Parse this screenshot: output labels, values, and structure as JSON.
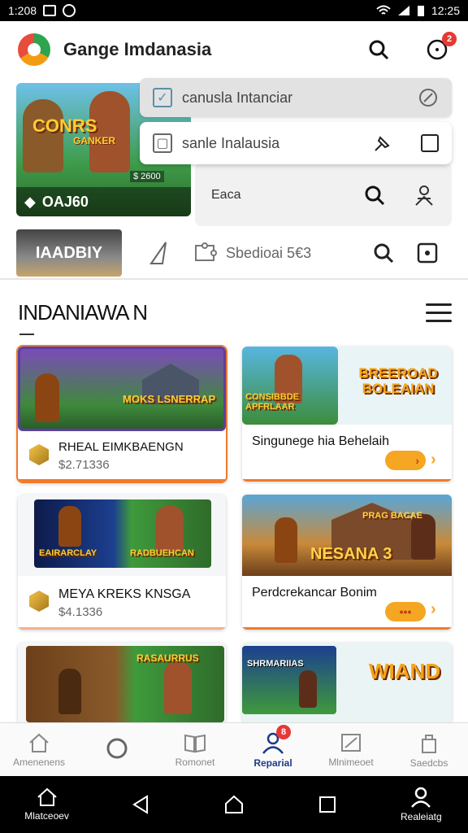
{
  "status_bar": {
    "time_left": "1:208",
    "time_right": "12:25"
  },
  "app_bar": {
    "title": "Gange Imdanasia",
    "notification_count": "2"
  },
  "featured": {
    "title": "CONRS",
    "subtitle": "GANKER",
    "price_tag": "$ 2600",
    "bar_text": "OAJ60"
  },
  "dropdown": {
    "item1_label": "canusla Intanciar",
    "item2_label": "sanle Inalausia",
    "item3_label": "Eaca"
  },
  "tabs": {
    "active_label": "IAADBIY",
    "search_label": "Sbedioai 5€3"
  },
  "section": {
    "title": "INDANIAWA N"
  },
  "cards": [
    {
      "art_text": "MOKS LSNERRAP",
      "name": "RHEAL EIMKBAENGN",
      "price": "$2.71336"
    },
    {
      "art_text": "BREEROAD BOLEAIAN",
      "art_sub": "CONSIBBDE APFRLAAR",
      "name": "Singunege hia Behelaih"
    },
    {
      "art_text": "EAIRARCLAY",
      "art_text2": "RADBUEHCAN",
      "name": "MEYA KREKS KNSGA",
      "price": "$4.1336"
    },
    {
      "art_text": "NESANA 3",
      "art_sub": "PRAG BACAE",
      "name": "Perdcrekancar Bonim"
    },
    {
      "art_text": "RASAURRUS",
      "name": ""
    },
    {
      "art_text": "SHRMARIIAS",
      "art_text2": "WIAND",
      "name": ""
    }
  ],
  "bottom_nav": [
    {
      "label": "Amenenens"
    },
    {
      "label": ""
    },
    {
      "label": "Romonet"
    },
    {
      "label": "Reparial",
      "badge": "8"
    },
    {
      "label": "Mlnimeoet"
    },
    {
      "label": "Saedcbs"
    }
  ],
  "system_nav": {
    "left_label": "Mlatceoev",
    "right_label": "Realeiatg"
  },
  "colors": {
    "accent": "#f07a2a",
    "active_nav": "#1e3a8a",
    "pill": "#f5a623"
  }
}
